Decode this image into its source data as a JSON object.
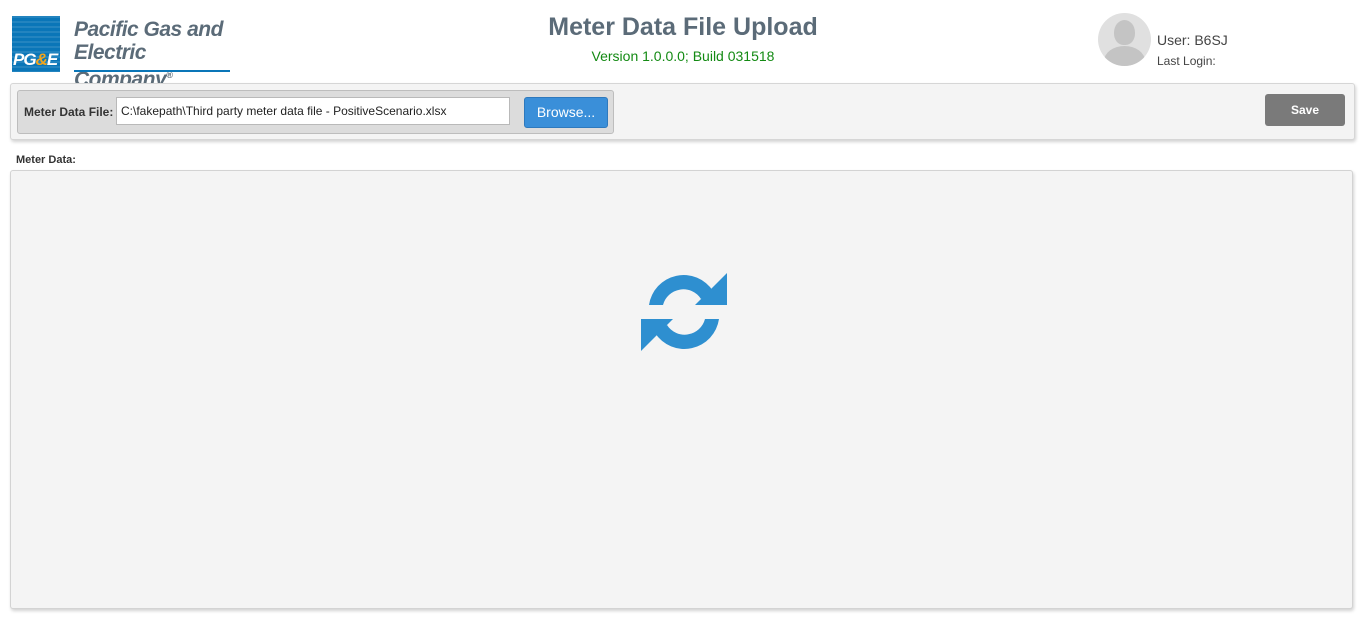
{
  "header": {
    "logo": {
      "mark_text_1": "PG",
      "mark_text_amp": "&",
      "mark_text_2": "E",
      "name_line1": "Pacific Gas and",
      "name_line2": "Electric Company",
      "registered": "®"
    },
    "title": "Meter Data File Upload",
    "version": "Version 1.0.0.0; Build 031518",
    "user": {
      "name_label": "User: B6SJ",
      "last_login_label": "Last Login:"
    }
  },
  "toolbar": {
    "file_label": "Meter Data File:",
    "file_value": "C:\\fakepath\\Third party meter data file - PositiveScenario.xlsx",
    "browse_label": "Browse...",
    "save_label": "Save"
  },
  "main": {
    "section_label": "Meter Data:",
    "loading_icon": "refresh-icon"
  },
  "colors": {
    "brand_blue": "#0a76b8",
    "title_gray": "#5b6b78",
    "version_green": "#138a13",
    "browse_blue": "#3a8fd9",
    "save_gray": "#7a7a7a",
    "icon_blue": "#2e8fd0"
  }
}
